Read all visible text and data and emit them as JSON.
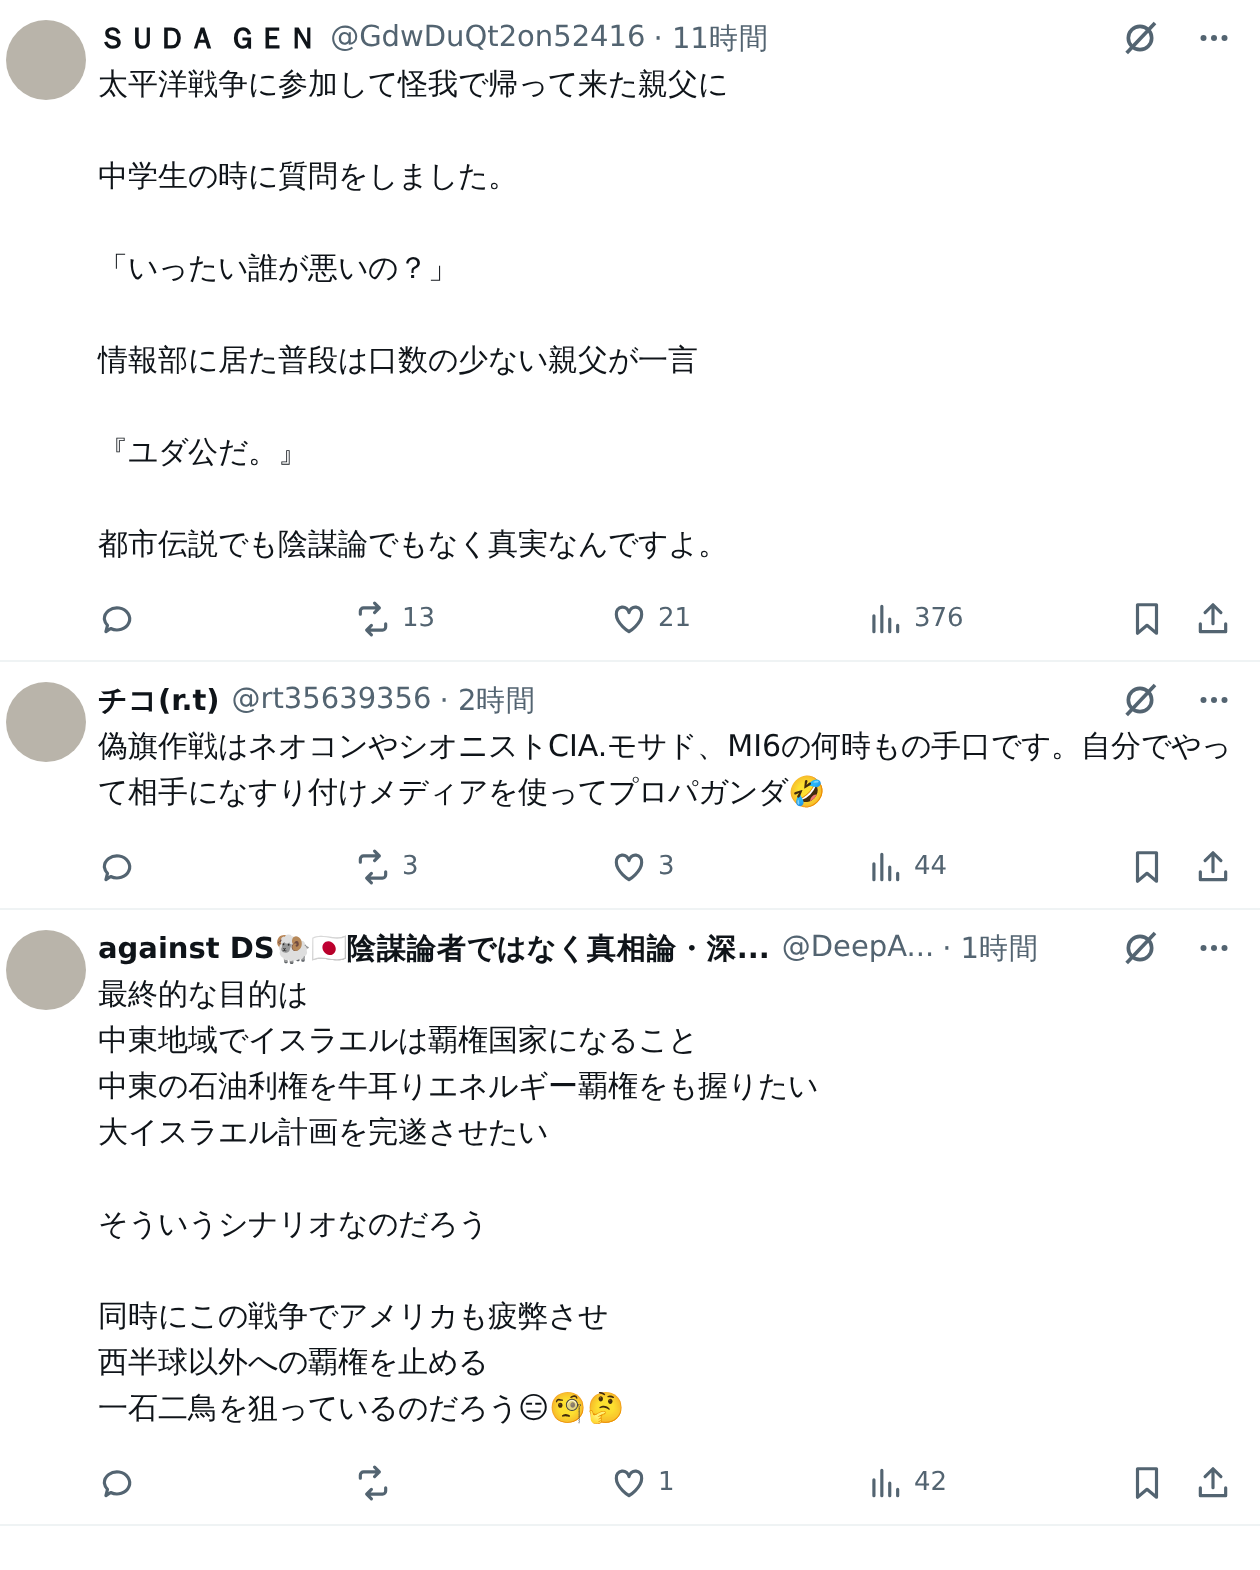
{
  "posts": [
    {
      "name": "ＳＵＤＡ ＧＥＮ",
      "handle": "@GdwDuQt2on52416",
      "time": "· 11時間",
      "paragraphs": [
        [
          "太平洋戦争に参加して怪我で帰って来た親父に"
        ],
        [
          "中学生の時に質問をしました。"
        ],
        [
          "「いったい誰が悪いの？」"
        ],
        [
          "情報部に居た普段は口数の少ない親父が一言"
        ],
        [
          "『ユダ公だ。』"
        ],
        [
          "都市伝説でも陰謀論でもなく真実なんですよ。"
        ]
      ],
      "reposts": "13",
      "likes": "21",
      "views": "376"
    },
    {
      "name": "チコ(r.t)",
      "handle": "@rt35639356",
      "time": "· 2時間",
      "paragraphs": [
        [
          "偽旗作戦はネオコンやシオニストCIA.モサド、MI6の何時もの手口です。自分でやって相手になすり付けメディアを使ってプロパガンダ🤣"
        ]
      ],
      "reposts": "3",
      "likes": "3",
      "views": "44"
    },
    {
      "name": "against DS🐏🇯🇵陰謀論者ではなく真相論・深...",
      "handle": "@DeepA...",
      "time": "· 1時間",
      "paragraphs": [
        [
          "最終的な目的は",
          "中東地域でイスラエルは覇権国家になること",
          "中東の石油利権を牛耳りエネルギー覇権をも握りたい",
          "大イスラエル計画を完遂させたい"
        ],
        [
          "そういうシナリオなのだろう"
        ],
        [
          "同時にこの戦争でアメリカも疲弊させ",
          "西半球以外への覇権を止める",
          "一石二鳥を狙っているのだろう😑🧐🤔"
        ]
      ],
      "likes": "1",
      "views": "42"
    }
  ]
}
